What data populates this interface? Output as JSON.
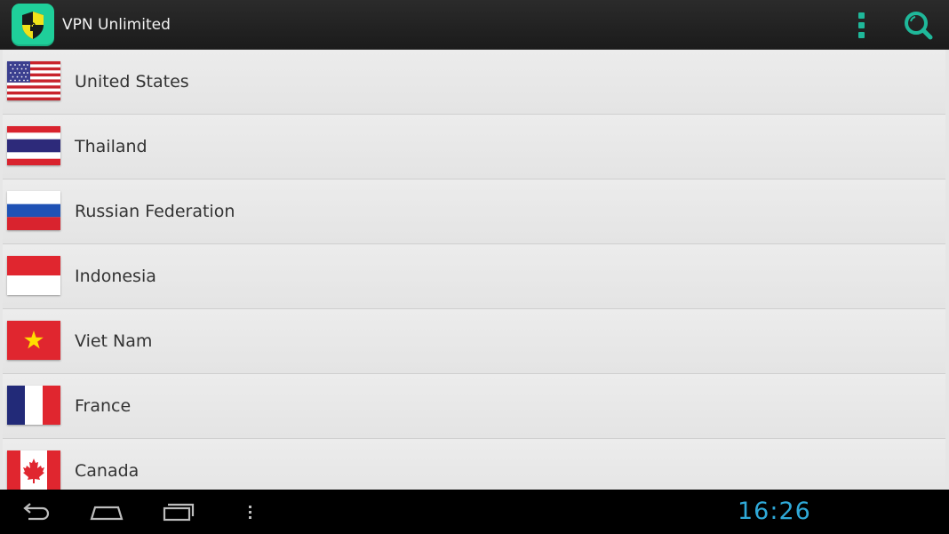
{
  "app": {
    "title": "VPN Unlimited",
    "icon": "shield-lock-icon",
    "accent": "#1fcf9a",
    "menu_icon": "overflow-menu-icon",
    "search_icon": "search-icon"
  },
  "countries": [
    {
      "name": "United States",
      "flag": "us-flag-icon"
    },
    {
      "name": "Thailand",
      "flag": "thailand-flag-icon"
    },
    {
      "name": "Russian Federation",
      "flag": "russia-flag-icon"
    },
    {
      "name": "Indonesia",
      "flag": "indonesia-flag-icon"
    },
    {
      "name": "Viet Nam",
      "flag": "vietnam-flag-icon"
    },
    {
      "name": "France",
      "flag": "france-flag-icon"
    },
    {
      "name": "Canada",
      "flag": "canada-flag-icon"
    }
  ],
  "system_bar": {
    "clock": "16:26",
    "clock_color": "#2fa9d8",
    "buttons": [
      "back-icon",
      "home-icon",
      "recent-apps-icon",
      "menu-dots-icon"
    ]
  }
}
